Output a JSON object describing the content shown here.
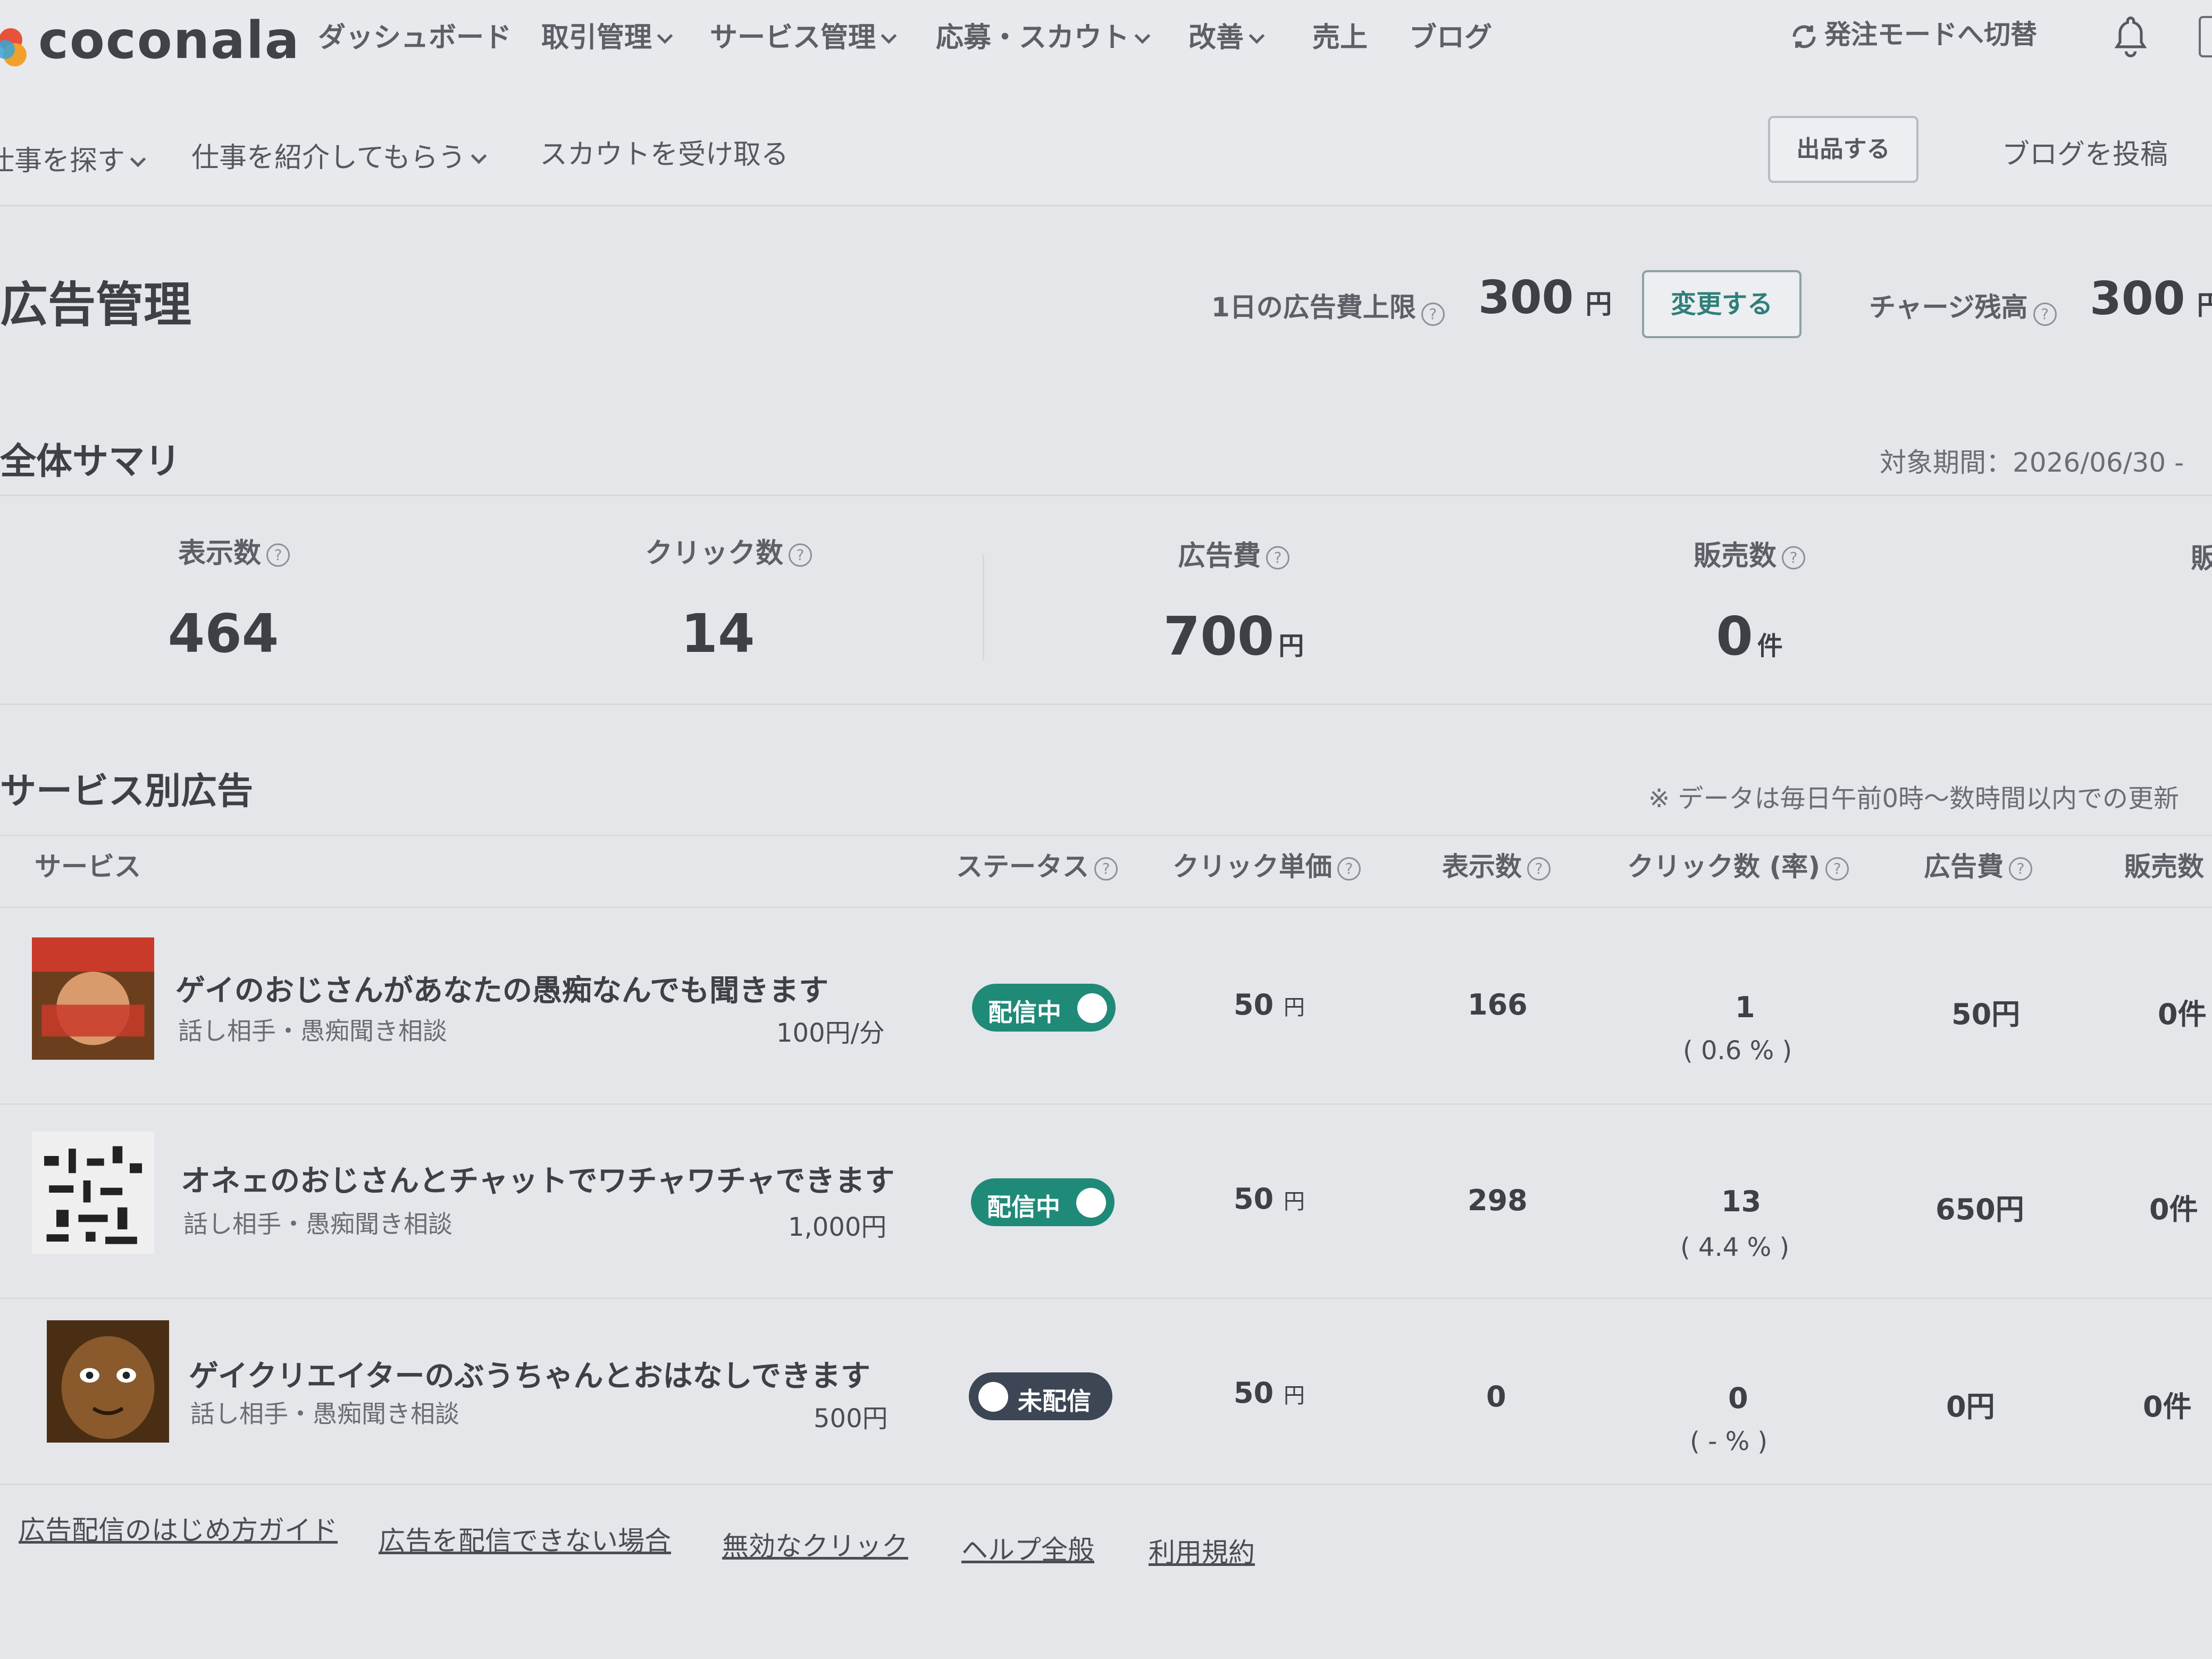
{
  "header": {
    "logo": "coconala",
    "nav": [
      {
        "label": "ダッシュボード",
        "caret": false
      },
      {
        "label": "取引管理",
        "caret": true
      },
      {
        "label": "サービス管理",
        "caret": true
      },
      {
        "label": "応募・スカウト",
        "caret": true
      },
      {
        "label": "改善",
        "caret": true
      },
      {
        "label": "売上",
        "caret": false
      },
      {
        "label": "ブログ",
        "caret": false
      }
    ],
    "mode_switch": "発注モードへ切替"
  },
  "subnav": {
    "items": [
      {
        "label": "仕事を探す",
        "caret": true
      },
      {
        "label": "仕事を紹介してもらう",
        "caret": true
      },
      {
        "label": "スカウトを受け取る",
        "caret": false
      }
    ],
    "publish_button": "出品する",
    "blog_post": "ブログを投稿"
  },
  "page": {
    "title": "広告管理",
    "daily_limit_label": "1日の広告費上限",
    "daily_limit_value": "300",
    "daily_limit_unit": "円",
    "change_button": "変更する",
    "balance_label": "チャージ残高",
    "balance_value": "300",
    "balance_unit": "円"
  },
  "summary": {
    "heading": "全体サマリ",
    "period_label": "対象期間：2026/06/30 -",
    "items": [
      {
        "label": "表示数",
        "value": "464",
        "unit": ""
      },
      {
        "label": "クリック数",
        "value": "14",
        "unit": ""
      },
      {
        "label": "広告費",
        "value": "700",
        "unit": "円"
      },
      {
        "label": "販売数",
        "value": "0",
        "unit": "件"
      },
      {
        "label": "販",
        "value": "",
        "unit": ""
      }
    ]
  },
  "ads": {
    "heading": "サービス別広告",
    "note": "※ データは毎日午前0時〜数時間以内での更新",
    "columns": [
      "サービス",
      "ステータス",
      "クリック単価",
      "表示数",
      "クリック数 (率)",
      "広告費",
      "販売数"
    ],
    "rows": [
      {
        "title": "ゲイのおじさんがあなたの愚痴なんでも聞きます",
        "category": "話し相手・愚痴聞き相談",
        "price": "100円/分",
        "status": "配信中",
        "status_on": true,
        "cpc": "50",
        "cpc_unit": "円",
        "impressions": "166",
        "clicks": "1",
        "rate": "( 0.6 % )",
        "cost": "50円",
        "sales": "0件"
      },
      {
        "title": "オネェのおじさんとチャットでワチャワチャできます",
        "category": "話し相手・愚痴聞き相談",
        "price": "1,000円",
        "status": "配信中",
        "status_on": true,
        "cpc": "50",
        "cpc_unit": "円",
        "impressions": "298",
        "clicks": "13",
        "rate": "( 4.4 % )",
        "cost": "650円",
        "sales": "0件"
      },
      {
        "title": "ゲイクリエイターのぶうちゃんとおはなしできます",
        "category": "話し相手・愚痴聞き相談",
        "price": "500円",
        "status": "未配信",
        "status_on": false,
        "cpc": "50",
        "cpc_unit": "円",
        "impressions": "0",
        "clicks": "0",
        "rate": "( - % )",
        "cost": "0円",
        "sales": "0件"
      }
    ]
  },
  "footer_links": [
    "広告配信のはじめ方ガイド",
    "広告を配信できない場合",
    "無効なクリック",
    "ヘルプ全般",
    "利用規約"
  ],
  "colors": {
    "status_on": "#1f8a78",
    "status_off": "#3c4655",
    "background": "#e4e6ea"
  }
}
